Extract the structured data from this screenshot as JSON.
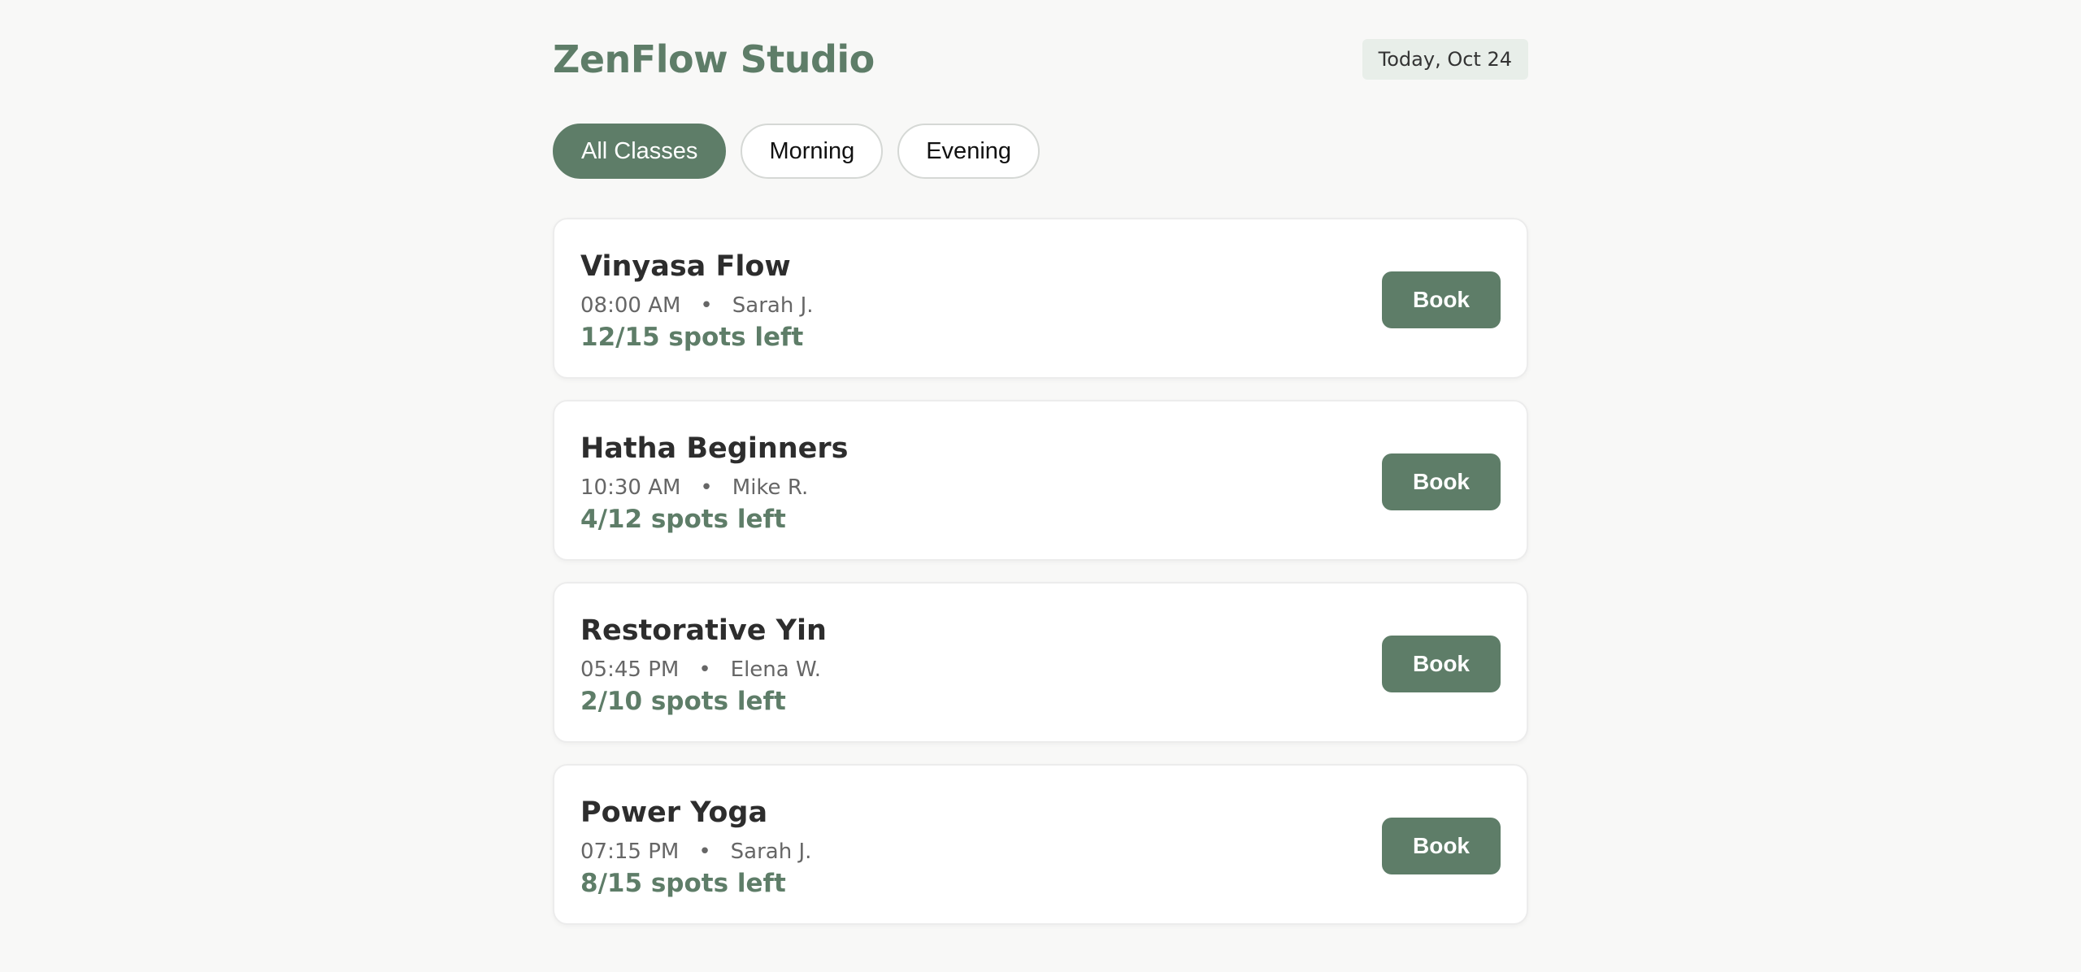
{
  "header": {
    "title": "ZenFlow Studio",
    "date": "Today, Oct 24"
  },
  "filters": [
    {
      "label": "All Classes",
      "active": true
    },
    {
      "label": "Morning",
      "active": false
    },
    {
      "label": "Evening",
      "active": false
    }
  ],
  "classes": [
    {
      "name": "Vinyasa Flow",
      "time": "08:00 AM",
      "instructor": "Sarah J.",
      "spots": "12/15 spots left",
      "action": "Book"
    },
    {
      "name": "Hatha Beginners",
      "time": "10:30 AM",
      "instructor": "Mike R.",
      "spots": "4/12 spots left",
      "action": "Book"
    },
    {
      "name": "Restorative Yin",
      "time": "05:45 PM",
      "instructor": "Elena W.",
      "spots": "2/10 spots left",
      "action": "Book"
    },
    {
      "name": "Power Yoga",
      "time": "07:15 PM",
      "instructor": "Sarah J.",
      "spots": "8/15 spots left",
      "action": "Book"
    }
  ],
  "meta_separator": "•",
  "colors": {
    "accent": "#5e7d68",
    "background": "#f8f8f7",
    "badge_bg": "#e8eee9"
  }
}
